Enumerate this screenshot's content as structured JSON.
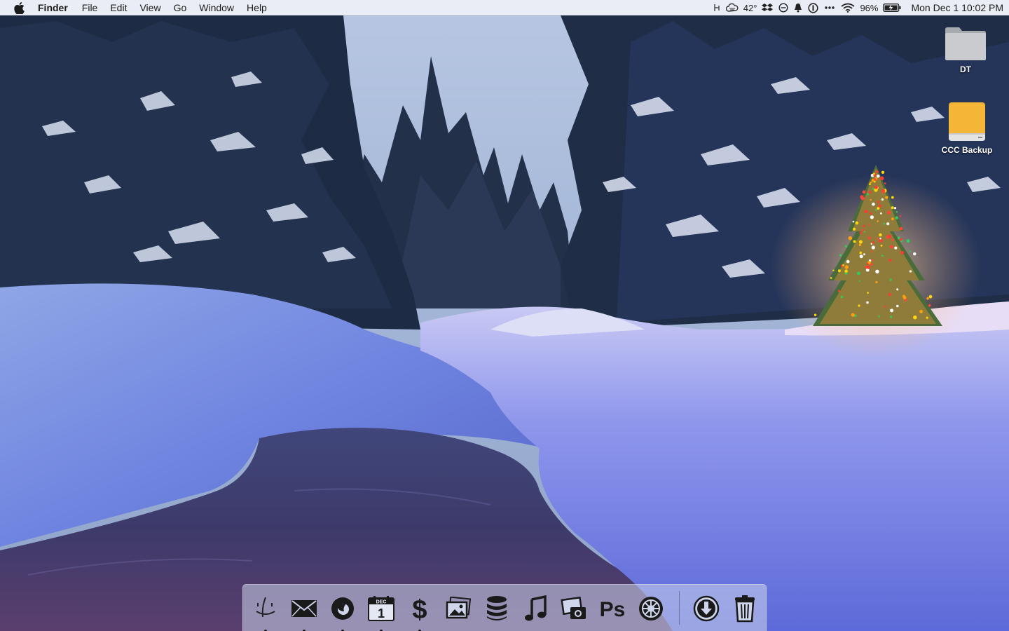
{
  "menubar": {
    "app_name": "Finder",
    "menus": [
      "File",
      "Edit",
      "View",
      "Go",
      "Window",
      "Help"
    ],
    "status_icons": [
      "marker-icon",
      "weather-icon",
      "dropbox-icon",
      "sync-icon",
      "notification-bell-icon",
      "onepassword-icon",
      "more-icon",
      "wifi-icon"
    ],
    "temperature": "42°",
    "battery_percent": "96%",
    "clock": "Mon Dec 1  10:02 PM"
  },
  "desktop": {
    "icons": [
      {
        "label": "DT",
        "icon": "folder-icon"
      },
      {
        "label": "CCC Backup",
        "icon": "external-drive-icon"
      }
    ]
  },
  "dock": {
    "apps": [
      {
        "name": "finder",
        "icon": "finder-icon",
        "running": true
      },
      {
        "name": "mail",
        "icon": "mail-icon",
        "running": true
      },
      {
        "name": "firefox",
        "icon": "firefox-icon",
        "running": true
      },
      {
        "name": "calendar",
        "icon": "calendar-icon",
        "running": true,
        "month": "DEC",
        "day": "1"
      },
      {
        "name": "money",
        "icon": "dollar-icon",
        "running": true
      },
      {
        "name": "preview",
        "icon": "photos-icon",
        "running": false
      },
      {
        "name": "database",
        "icon": "database-icon",
        "running": false
      },
      {
        "name": "music",
        "icon": "music-note-icon",
        "running": false
      },
      {
        "name": "image-capture",
        "icon": "camera-icon",
        "running": false
      },
      {
        "name": "photoshop",
        "icon": "photoshop-icon",
        "running": false,
        "label": "Ps"
      },
      {
        "name": "system-preferences",
        "icon": "gear-icon",
        "running": false
      }
    ],
    "stacks": [
      {
        "name": "downloads",
        "icon": "downloads-icon"
      },
      {
        "name": "trash",
        "icon": "trash-icon"
      }
    ]
  },
  "colors": {
    "menubar_bg": "#eef0f6",
    "dock_glyph": "#1a1a1a",
    "folder": "#c9cbce",
    "drive": "#f5b537"
  }
}
